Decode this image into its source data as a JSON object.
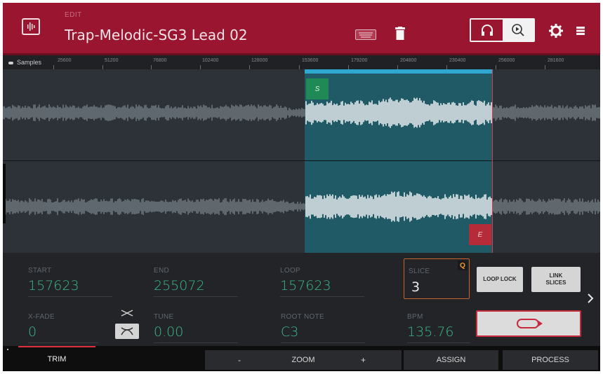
{
  "header": {
    "subtitle": "EDIT",
    "title": "Trap-Melodic-SG3 Lead 02",
    "icons": [
      "waveform-app-icon",
      "keyboard-icon",
      "trash-icon",
      "headphone-icon",
      "play-search-icon",
      "gear-icon",
      "stack-icon"
    ],
    "accent_color": "#9a1530"
  },
  "timeline": {
    "unit_label": "Samples",
    "ticks": [
      "25600",
      "51200",
      "76800",
      "102400",
      "128000",
      "153600",
      "179200",
      "204800",
      "230400",
      "256000",
      "281600"
    ]
  },
  "waveform": {
    "start_marker": "S",
    "end_marker": "E",
    "selection_color": "#1f5a66"
  },
  "params": {
    "start": {
      "label": "START",
      "value": "157623"
    },
    "end": {
      "label": "END",
      "value": "255072"
    },
    "loop": {
      "label": "LOOP",
      "value": "157623"
    },
    "slice": {
      "label": "SLICE",
      "value": "3",
      "badge": "Q"
    },
    "xfade": {
      "label": "X-FADE",
      "value": "0"
    },
    "tune": {
      "label": "TUNE",
      "value": "0.00"
    },
    "root_note": {
      "label": "ROOT NOTE",
      "value": "C3"
    },
    "bpm": {
      "label": "BPM",
      "value": "135.76"
    },
    "value_color": "#3bb88a"
  },
  "buttons": {
    "loop_lock": "LOOP LOCK",
    "link_slices_line1": "LINK",
    "link_slices_line2": "SLICES"
  },
  "bottom": {
    "trim": "TRIM",
    "zoom_minus": "-",
    "zoom": "ZOOM",
    "zoom_plus": "+",
    "assign": "ASSIGN",
    "process": "PROCESS"
  }
}
